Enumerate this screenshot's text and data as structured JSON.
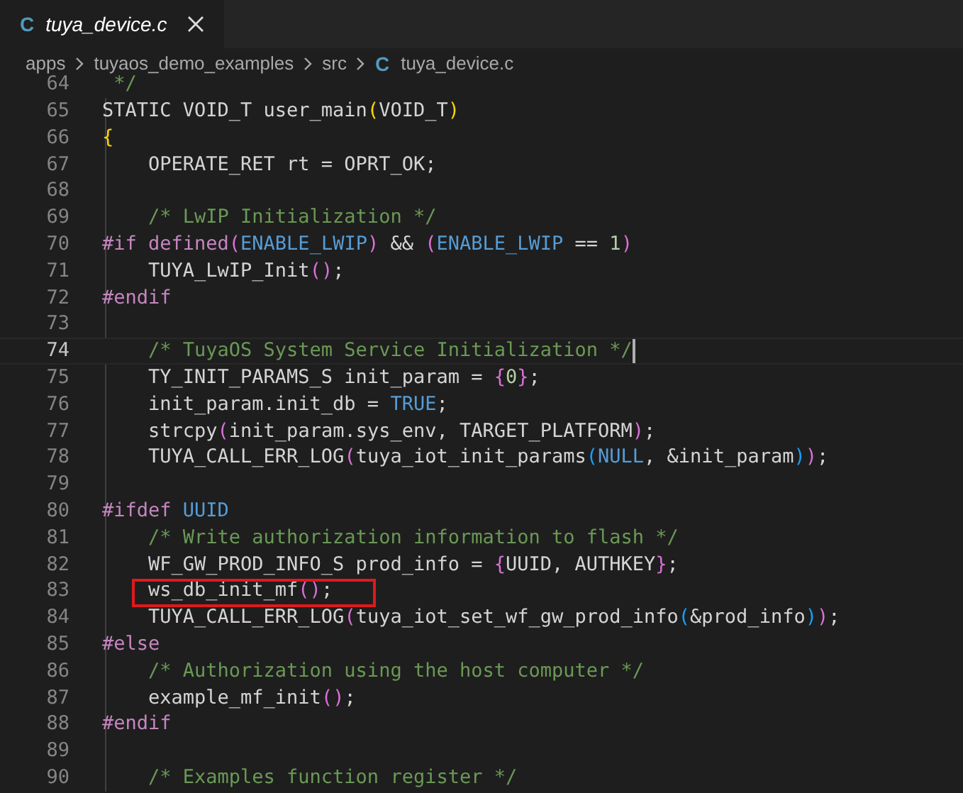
{
  "tab": {
    "icon_letter": "C",
    "title": "tuya_device.c",
    "selected": true
  },
  "breadcrumbs": [
    {
      "label": "apps"
    },
    {
      "label": "tuyaos_demo_examples"
    },
    {
      "label": "src"
    },
    {
      "label": "tuya_device.c",
      "icon_letter": "C"
    }
  ],
  "lines": [
    {
      "number": "64",
      "current": false,
      "boxed": false,
      "tokens": [
        {
          "kind": "comment",
          "text": " */"
        }
      ]
    },
    {
      "number": "65",
      "current": false,
      "boxed": false,
      "tokens": [
        {
          "kind": "text",
          "text": "STATIC VOID_T user_main"
        },
        {
          "kind": "p1",
          "text": "("
        },
        {
          "kind": "text",
          "text": "VOID_T"
        },
        {
          "kind": "p1",
          "text": ")"
        }
      ]
    },
    {
      "number": "66",
      "current": false,
      "boxed": false,
      "tokens": [
        {
          "kind": "p1",
          "text": "{"
        }
      ]
    },
    {
      "number": "67",
      "current": false,
      "boxed": false,
      "tokens": [
        {
          "kind": "text",
          "text": "    OPERATE_RET rt = OPRT_OK;"
        }
      ]
    },
    {
      "number": "68",
      "current": false,
      "boxed": false
    },
    {
      "number": "69",
      "current": false,
      "boxed": false,
      "tokens": [
        {
          "kind": "comment",
          "text": "    /* LwIP Initialization */"
        }
      ]
    },
    {
      "number": "70",
      "current": false,
      "boxed": false,
      "tokens": [
        {
          "kind": "directive",
          "text": "#if defined"
        },
        {
          "kind": "p2",
          "text": "("
        },
        {
          "kind": "const",
          "text": "ENABLE_LWIP"
        },
        {
          "kind": "p2",
          "text": ")"
        },
        {
          "kind": "text",
          "text": " && "
        },
        {
          "kind": "p2",
          "text": "("
        },
        {
          "kind": "const",
          "text": "ENABLE_LWIP"
        },
        {
          "kind": "text",
          "text": " == "
        },
        {
          "kind": "num",
          "text": "1"
        },
        {
          "kind": "p2",
          "text": ")"
        }
      ]
    },
    {
      "number": "71",
      "current": false,
      "boxed": false,
      "tokens": [
        {
          "kind": "text",
          "text": "    TUYA_LwIP_Init"
        },
        {
          "kind": "p2",
          "text": "()"
        },
        {
          "kind": "text",
          "text": ";"
        }
      ]
    },
    {
      "number": "72",
      "current": false,
      "boxed": false,
      "tokens": [
        {
          "kind": "directive",
          "text": "#endif"
        }
      ]
    },
    {
      "number": "73",
      "current": false,
      "boxed": false
    },
    {
      "number": "74",
      "current": true,
      "boxed": false,
      "tokens": [
        {
          "kind": "comment",
          "text": "    /* TuyaOS System Service Initialization */"
        }
      ]
    },
    {
      "number": "75",
      "current": false,
      "boxed": false,
      "tokens": [
        {
          "kind": "text",
          "text": "    TY_INIT_PARAMS_S init_param = "
        },
        {
          "kind": "p2",
          "text": "{"
        },
        {
          "kind": "num",
          "text": "0"
        },
        {
          "kind": "p2",
          "text": "}"
        },
        {
          "kind": "text",
          "text": ";"
        }
      ]
    },
    {
      "number": "76",
      "current": false,
      "boxed": false,
      "tokens": [
        {
          "kind": "text",
          "text": "    init_param.init_db = "
        },
        {
          "kind": "const",
          "text": "TRUE"
        },
        {
          "kind": "text",
          "text": ";"
        }
      ]
    },
    {
      "number": "77",
      "current": false,
      "boxed": false,
      "tokens": [
        {
          "kind": "text",
          "text": "    strcpy"
        },
        {
          "kind": "p2",
          "text": "("
        },
        {
          "kind": "text",
          "text": "init_param.sys_env, TARGET_PLATFORM"
        },
        {
          "kind": "p2",
          "text": ")"
        },
        {
          "kind": "text",
          "text": ";"
        }
      ]
    },
    {
      "number": "78",
      "current": false,
      "boxed": false,
      "tokens": [
        {
          "kind": "text",
          "text": "    TUYA_CALL_ERR_LOG"
        },
        {
          "kind": "p2",
          "text": "("
        },
        {
          "kind": "text",
          "text": "tuya_iot_init_params"
        },
        {
          "kind": "p3",
          "text": "("
        },
        {
          "kind": "const",
          "text": "NULL"
        },
        {
          "kind": "text",
          "text": ", &init_param"
        },
        {
          "kind": "p3",
          "text": ")"
        },
        {
          "kind": "p2",
          "text": ")"
        },
        {
          "kind": "text",
          "text": ";"
        }
      ]
    },
    {
      "number": "79",
      "current": false,
      "boxed": false
    },
    {
      "number": "80",
      "current": false,
      "boxed": false,
      "tokens": [
        {
          "kind": "directive",
          "text": "#ifdef "
        },
        {
          "kind": "const",
          "text": "UUID"
        }
      ]
    },
    {
      "number": "81",
      "current": false,
      "boxed": false,
      "tokens": [
        {
          "kind": "comment",
          "text": "    /* Write authorization information to flash */"
        }
      ]
    },
    {
      "number": "82",
      "current": false,
      "boxed": false,
      "tokens": [
        {
          "kind": "text",
          "text": "    WF_GW_PROD_INFO_S prod_info = "
        },
        {
          "kind": "p2",
          "text": "{"
        },
        {
          "kind": "text",
          "text": "UUID, AUTHKEY"
        },
        {
          "kind": "p2",
          "text": "}"
        },
        {
          "kind": "text",
          "text": ";"
        }
      ]
    },
    {
      "number": "83",
      "current": false,
      "boxed": true,
      "tokens": [
        {
          "kind": "text",
          "text": "    ws_db_init_mf"
        },
        {
          "kind": "p2",
          "text": "()"
        },
        {
          "kind": "text",
          "text": ";"
        }
      ]
    },
    {
      "number": "84",
      "current": false,
      "boxed": false,
      "tokens": [
        {
          "kind": "text",
          "text": "    TUYA_CALL_ERR_LOG"
        },
        {
          "kind": "p2",
          "text": "("
        },
        {
          "kind": "text",
          "text": "tuya_iot_set_wf_gw_prod_info"
        },
        {
          "kind": "p3",
          "text": "("
        },
        {
          "kind": "text",
          "text": "&prod_info"
        },
        {
          "kind": "p3",
          "text": ")"
        },
        {
          "kind": "p2",
          "text": ")"
        },
        {
          "kind": "text",
          "text": ";"
        }
      ]
    },
    {
      "number": "85",
      "current": false,
      "boxed": false,
      "tokens": [
        {
          "kind": "directive",
          "text": "#else"
        }
      ]
    },
    {
      "number": "86",
      "current": false,
      "boxed": false,
      "tokens": [
        {
          "kind": "comment",
          "text": "    /* Authorization using the host computer */"
        }
      ]
    },
    {
      "number": "87",
      "current": false,
      "boxed": false,
      "tokens": [
        {
          "kind": "text",
          "text": "    example_mf_init"
        },
        {
          "kind": "p2",
          "text": "()"
        },
        {
          "kind": "text",
          "text": ";"
        }
      ]
    },
    {
      "number": "88",
      "current": false,
      "boxed": false,
      "tokens": [
        {
          "kind": "directive",
          "text": "#endif"
        }
      ]
    },
    {
      "number": "89",
      "current": false,
      "boxed": false
    },
    {
      "number": "90",
      "current": false,
      "boxed": false,
      "tokens": [
        {
          "kind": "comment",
          "text": "    /* Examples function register */"
        }
      ]
    }
  ]
}
